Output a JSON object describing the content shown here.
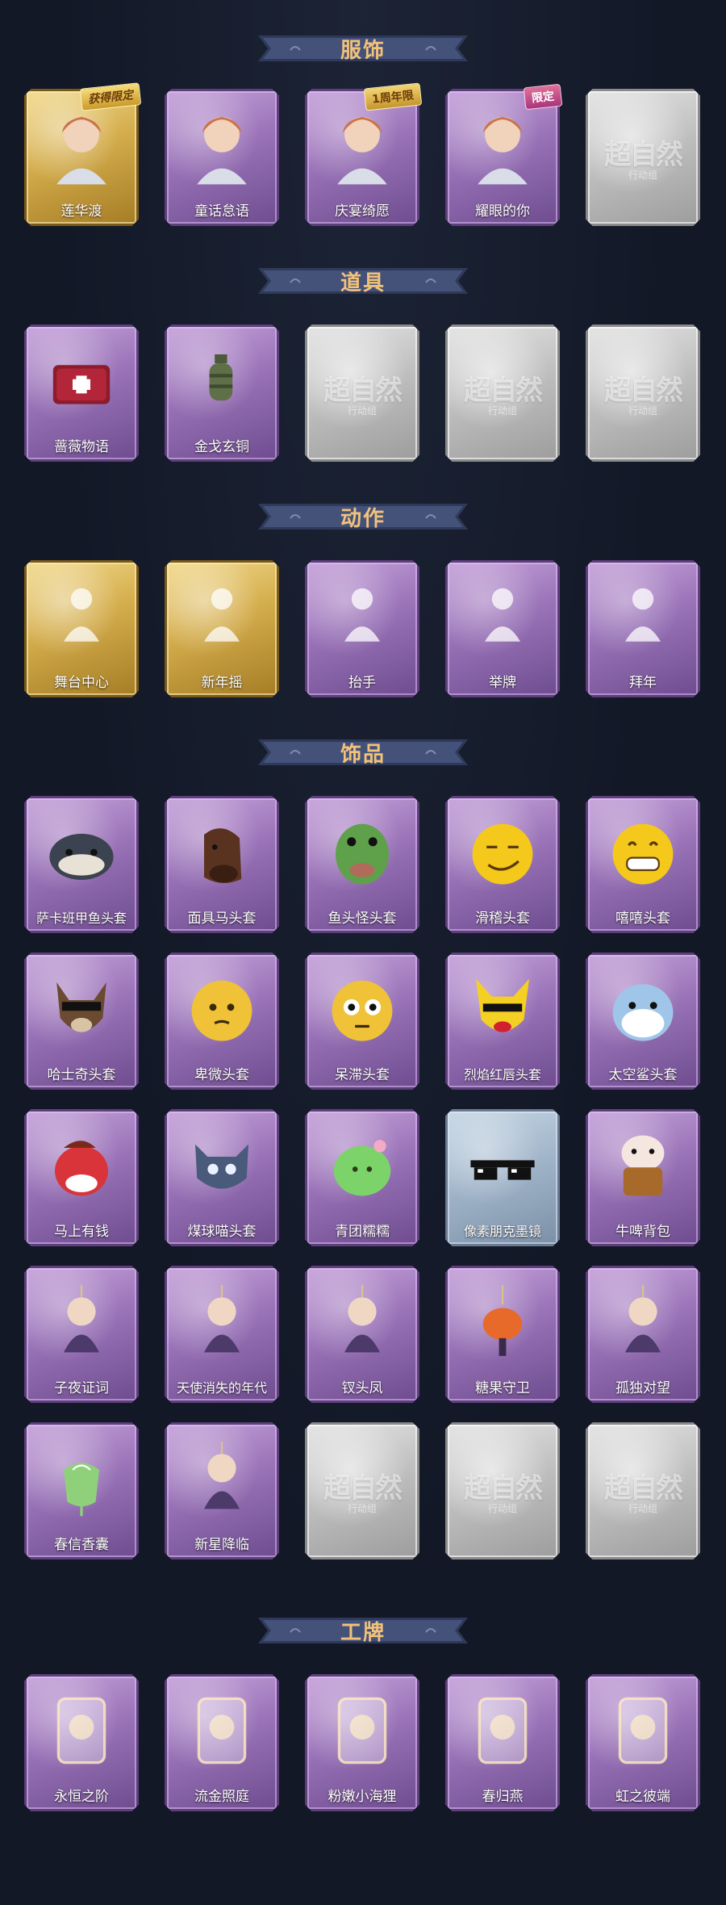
{
  "sections": [
    {
      "title": "服饰",
      "items": [
        {
          "name": "莲华渡",
          "rarity": "gold",
          "icon": "character-portrait-icon",
          "badge": "获得限定",
          "badge_type": "award"
        },
        {
          "name": "童话怠语",
          "rarity": "purple",
          "icon": "character-portrait-icon"
        },
        {
          "name": "庆宴绮愿",
          "rarity": "purple",
          "icon": "character-portrait-icon",
          "badge": "1周年限",
          "badge_type": "anniv"
        },
        {
          "name": "耀眼的你",
          "rarity": "purple",
          "icon": "character-portrait-icon",
          "badge": "限定",
          "badge_type": "limited"
        },
        {
          "name": "",
          "rarity": "gray",
          "icon": "placeholder-logo-icon",
          "placeholder": "超自然",
          "placeholder_sub": "行动组"
        }
      ]
    },
    {
      "title": "道具",
      "items": [
        {
          "name": "蔷薇物语",
          "rarity": "purple",
          "icon": "medkit-icon"
        },
        {
          "name": "金戈玄铜",
          "rarity": "purple",
          "icon": "grenade-icon"
        },
        {
          "name": "",
          "rarity": "gray",
          "icon": "placeholder-logo-icon",
          "placeholder": "超自然",
          "placeholder_sub": "行动组"
        },
        {
          "name": "",
          "rarity": "gray",
          "icon": "placeholder-logo-icon",
          "placeholder": "超自然",
          "placeholder_sub": "行动组"
        },
        {
          "name": "",
          "rarity": "gray",
          "icon": "placeholder-logo-icon",
          "placeholder": "超自然",
          "placeholder_sub": "行动组"
        }
      ]
    },
    {
      "title": "动作",
      "items": [
        {
          "name": "舞台中心",
          "rarity": "gold",
          "icon": "pose-figure-icon"
        },
        {
          "name": "新年摇",
          "rarity": "gold",
          "icon": "pose-figure-icon"
        },
        {
          "name": "抬手",
          "rarity": "purple",
          "icon": "pose-figure-icon"
        },
        {
          "name": "举牌",
          "rarity": "purple",
          "icon": "pose-figure-icon"
        },
        {
          "name": "拜年",
          "rarity": "purple",
          "icon": "pose-figure-icon"
        }
      ]
    },
    {
      "title": "饰品",
      "items": [
        {
          "name": "萨卡班甲鱼头套",
          "rarity": "purple",
          "icon": "fish-head-icon"
        },
        {
          "name": "面具马头套",
          "rarity": "purple",
          "icon": "horse-head-icon"
        },
        {
          "name": "鱼头怪头套",
          "rarity": "purple",
          "icon": "fish-monster-head-icon"
        },
        {
          "name": "滑稽头套",
          "rarity": "purple",
          "icon": "smirk-face-icon"
        },
        {
          "name": "嘻嘻头套",
          "rarity": "purple",
          "icon": "grin-face-icon"
        },
        {
          "name": "哈士奇头套",
          "rarity": "purple",
          "icon": "dog-head-icon"
        },
        {
          "name": "卑微头套",
          "rarity": "purple",
          "icon": "humble-face-icon"
        },
        {
          "name": "呆滞头套",
          "rarity": "purple",
          "icon": "stare-face-icon"
        },
        {
          "name": "烈焰红唇头套",
          "rarity": "purple",
          "icon": "pikachu-head-icon"
        },
        {
          "name": "太空鲨头套",
          "rarity": "purple",
          "icon": "shark-head-icon"
        },
        {
          "name": "马上有钱",
          "rarity": "purple",
          "icon": "red-horse-icon"
        },
        {
          "name": "煤球喵头套",
          "rarity": "purple",
          "icon": "cat-head-icon"
        },
        {
          "name": "青团糯糯",
          "rarity": "purple",
          "icon": "green-dumpling-icon"
        },
        {
          "name": "像素朋克墨镜",
          "rarity": "blue",
          "icon": "pixel-sunglasses-icon"
        },
        {
          "name": "牛啤背包",
          "rarity": "purple",
          "icon": "cow-backpack-icon"
        },
        {
          "name": "子夜证词",
          "rarity": "purple",
          "icon": "charm-doll-icon"
        },
        {
          "name": "天使消失的年代",
          "rarity": "purple",
          "icon": "charm-doll-icon"
        },
        {
          "name": "钗头凤",
          "rarity": "purple",
          "icon": "charm-doll-icon"
        },
        {
          "name": "糖果守卫",
          "rarity": "purple",
          "icon": "pumpkin-charm-icon"
        },
        {
          "name": "孤独对望",
          "rarity": "purple",
          "icon": "charm-doll-icon"
        },
        {
          "name": "春信香囊",
          "rarity": "purple",
          "icon": "sachet-icon"
        },
        {
          "name": "新星降临",
          "rarity": "purple",
          "icon": "charm-doll-icon"
        },
        {
          "name": "",
          "rarity": "gray",
          "icon": "placeholder-logo-icon",
          "placeholder": "超自然",
          "placeholder_sub": "行动组"
        },
        {
          "name": "",
          "rarity": "gray",
          "icon": "placeholder-logo-icon",
          "placeholder": "超自然",
          "placeholder_sub": "行动组"
        },
        {
          "name": "",
          "rarity": "gray",
          "icon": "placeholder-logo-icon",
          "placeholder": "超自然",
          "placeholder_sub": "行动组"
        }
      ]
    },
    {
      "title": "工牌",
      "items": [
        {
          "name": "永恒之阶",
          "rarity": "purple",
          "icon": "badge-card-icon"
        },
        {
          "name": "流金照庭",
          "rarity": "purple",
          "icon": "badge-card-icon"
        },
        {
          "name": "粉嫩小海狸",
          "rarity": "purple",
          "icon": "badge-card-icon"
        },
        {
          "name": "春归燕",
          "rarity": "purple",
          "icon": "badge-card-icon"
        },
        {
          "name": "虹之彼端",
          "rarity": "purple",
          "icon": "badge-card-icon"
        }
      ]
    }
  ],
  "colors": {
    "background": "#121826",
    "title": "#f2c27a",
    "purple": "#9a73b8",
    "gold": "#d4ad4c",
    "gray": "#bdbdbd",
    "blue": "#9fb3c8"
  }
}
